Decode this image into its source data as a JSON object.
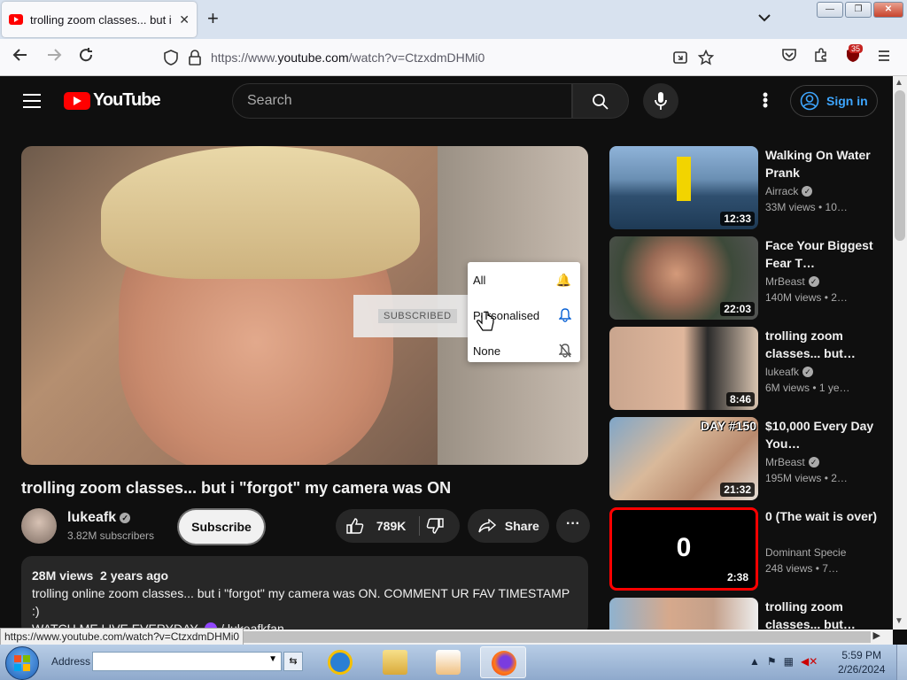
{
  "browser": {
    "tab_title": "trolling zoom classes... but i \"forgot\" my camera was ON - YouTube",
    "tab_close": "✕",
    "new_tab": "+",
    "url_prefix": "https://www.",
    "url_host": "youtube.com",
    "url_path": "/watch?v=CtzxdmDHMi0",
    "extension_badge": "35",
    "win_minimize": "—",
    "win_restore": "❐",
    "win_close": "✕"
  },
  "youtube": {
    "logo_text": "YouTube",
    "search_placeholder": "Search",
    "sign_in": "Sign in"
  },
  "player": {
    "subscribed_label": "SUBSCRIBED",
    "notification_options": [
      {
        "label": "All",
        "icon": "bell-ring-icon"
      },
      {
        "label": "Personalised",
        "icon": "bell-icon"
      },
      {
        "label": "None",
        "icon": "bell-off-icon"
      }
    ]
  },
  "video": {
    "title": "trolling zoom classes... but i \"forgot\" my camera was ON",
    "channel": "lukeafk",
    "subscribers": "3.82M subscribers",
    "subscribe_label": "Subscribe",
    "likes": "789K",
    "share_label": "Share",
    "views": "28M views",
    "age": "2 years ago",
    "description_line1": "trolling online zoom classes... but i \"forgot\" my camera was ON. COMMENT UR FAV TIMESTAMP :)",
    "description_line2": "WATCH ME LIVE EVERYDAY-",
    "twitch_link": "/ lukeafkfan"
  },
  "related": [
    {
      "title": "Walking On Water Prank",
      "channel": "Airrack",
      "meta": "33M views • 10…",
      "duration": "12:33"
    },
    {
      "title": "Face Your Biggest Fear T…",
      "channel": "MrBeast",
      "meta": "140M views • 2…",
      "duration": "22:03"
    },
    {
      "title": "trolling zoom classes... but…",
      "channel": "lukeafk",
      "meta": "6M views • 1 ye…",
      "duration": "8:46"
    },
    {
      "title": "$10,000 Every Day You…",
      "channel": "MrBeast",
      "meta": "195M views • 2…",
      "duration": "21:32",
      "thumb_text": "DAY #150"
    },
    {
      "title": "0 (The wait is over)",
      "channel": "Dominant Specie",
      "meta": "248 views • 7…",
      "duration": "2:38",
      "thumb_text": "0"
    },
    {
      "title": "trolling zoom classes... but…",
      "channel": "",
      "meta": "",
      "duration": ""
    }
  ],
  "status_bar_url": "https://www.youtube.com/watch?v=CtzxdmDHMi0",
  "taskbar": {
    "address_label": "Address",
    "time": "5:59 PM",
    "date": "2/26/2024"
  }
}
